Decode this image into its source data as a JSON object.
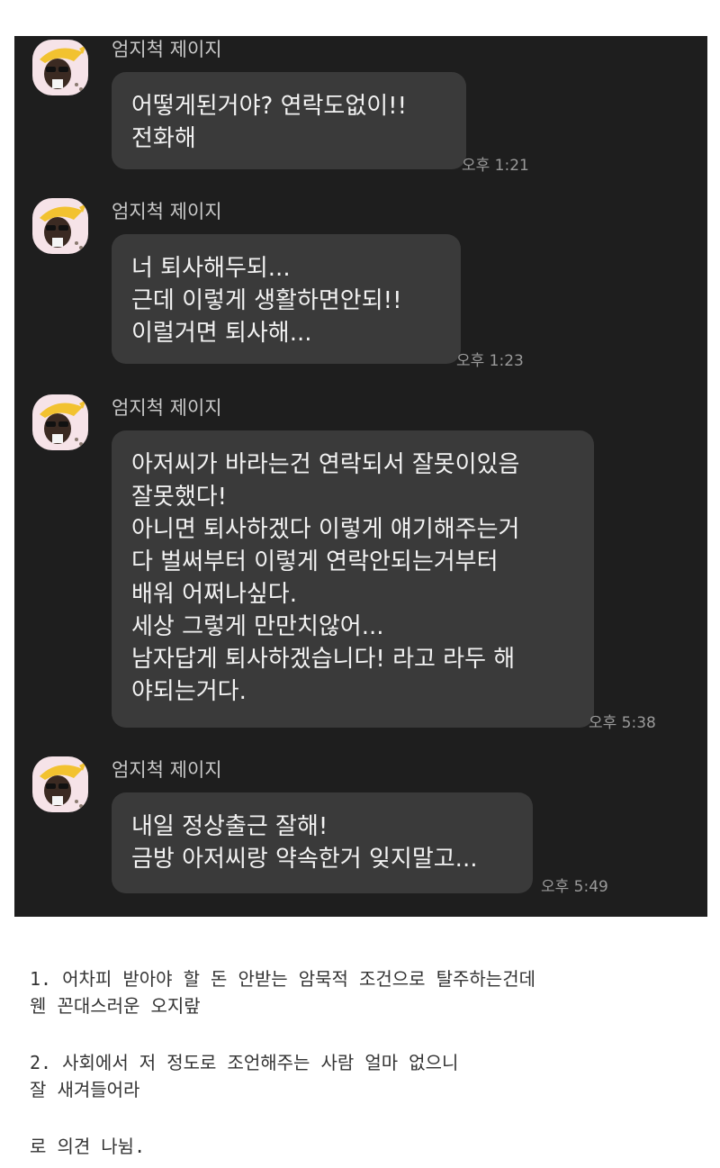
{
  "colors": {
    "chat_background": "#1e1e1e",
    "bubble": "#3a3a3a",
    "bubble_text": "#f2f2f2",
    "sender_text": "#c9c9c9",
    "time_text": "#9a9a9a",
    "avatar_background": "#f6e3e8"
  },
  "messages": [
    {
      "sender": "엄지척 제이지",
      "avatar_icon": "jay-g-character-icon",
      "lines": [
        "어떻게된거야? 연락도없이!!",
        "전화해"
      ],
      "time": "오후 1:21"
    },
    {
      "sender": "엄지척 제이지",
      "avatar_icon": "jay-g-character-icon",
      "lines": [
        "너 퇴사해두되...",
        "근데 이렇게 생활하면안되!!",
        "이럴거면 퇴사해..."
      ],
      "time": "오후 1:23"
    },
    {
      "sender": "엄지척 제이지",
      "avatar_icon": "jay-g-character-icon",
      "lines": [
        "아저씨가 바라는건 연락되서 잘못이있음",
        "잘못했다!",
        "아니면 퇴사하겠다 이렇게 얘기해주는거",
        "다 벌써부터 이렇게 연락안되는거부터",
        "배워 어쩌나싶다.",
        "세상 그렇게 만만치않어...",
        "남자답게 퇴사하겠습니다! 라고 라두 해",
        "야되는거다."
      ],
      "time": "오후 5:38"
    },
    {
      "sender": "엄지척 제이지",
      "avatar_icon": "jay-g-character-icon",
      "lines": [
        "내일 정상출근 잘해!",
        "금방 아저씨랑 약속한거 잊지말고..."
      ],
      "time": "오후 5:49"
    }
  ],
  "comments": [
    [
      "1. 어차피 받아야 할 돈 안받는 암묵적 조건으로 탈주하는건데",
      "웬 꼰대스러운 오지랖"
    ],
    [
      "2. 사회에서 저 정도로 조언해주는 사람 얼마 없으니",
      "잘 새겨들어라"
    ],
    [
      "로 의견 나뉨."
    ]
  ]
}
